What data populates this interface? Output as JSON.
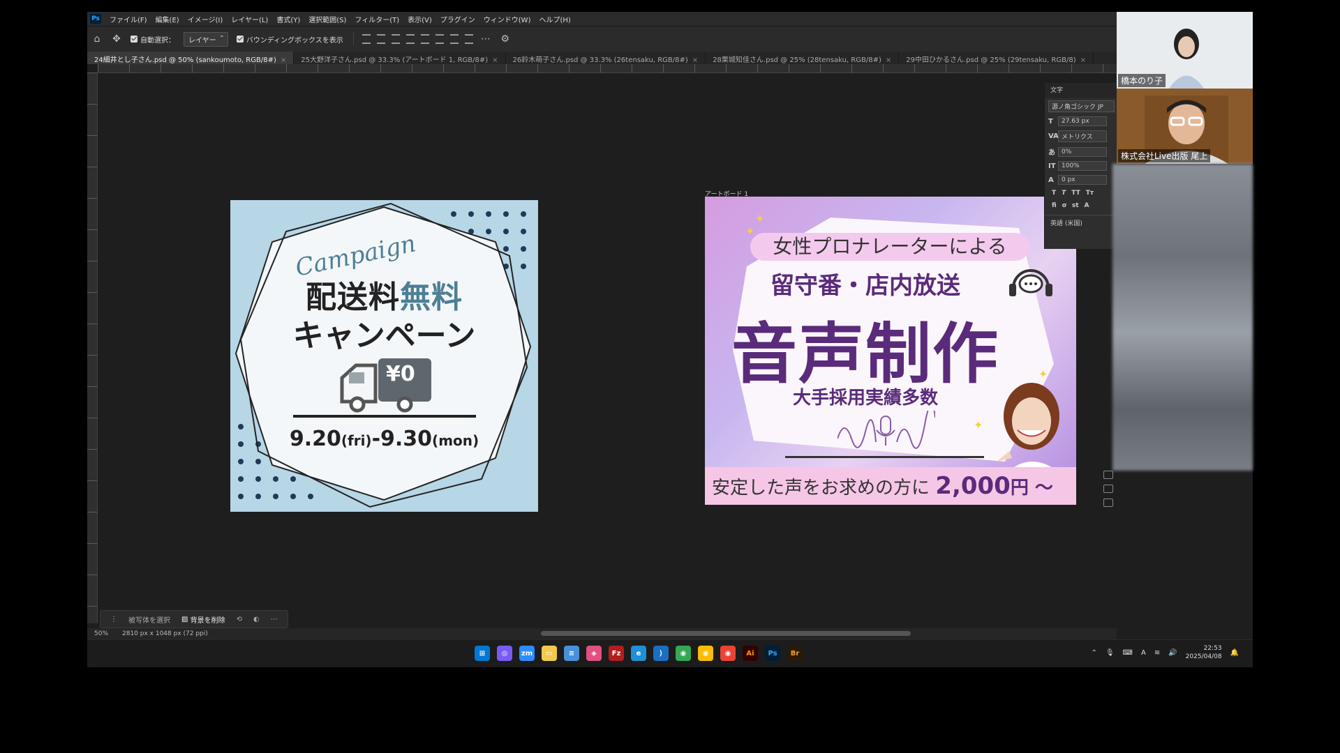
{
  "menu": {
    "items": [
      "ファイル(F)",
      "編集(E)",
      "イメージ(I)",
      "レイヤー(L)",
      "書式(Y)",
      "選択範囲(S)",
      "フィルター(T)",
      "表示(V)",
      "プラグイン",
      "ウィンドウ(W)",
      "ヘルプ(H)"
    ]
  },
  "options": {
    "auto_select": "自動選択：",
    "layer_select": "レイヤー",
    "bounding_box": "バウンディングボックスを表示"
  },
  "tabs": [
    {
      "label": "24細井とし子さん.psd @ 50% (sankoumoto, RGB/8#)"
    },
    {
      "label": "25大野洋子さん.psd @ 33.3% (アートボード 1, RGB/8#)"
    },
    {
      "label": "26鈴木萌子さん.psd @ 33.3% (26tensaku, RGB/8#)"
    },
    {
      "label": "28栗城知佳さん.psd @ 25% (28tensaku, RGB/8#)"
    },
    {
      "label": "29中田ひかるさん.psd @ 25% (29tensaku, RGB/8)"
    }
  ],
  "artwork_left": {
    "script": "Campaign",
    "title_part1": "配送料",
    "title_part2": "無料",
    "title_line2": "キャンペーン",
    "truck_label": "¥0",
    "date_start": "9.20",
    "date_start_day": "(fri)",
    "date_sep": "-",
    "date_end": "9.30",
    "date_end_day": "(mon)"
  },
  "artboard_label": "アートボード 1",
  "artwork_right": {
    "line1": "女性プロナレーターによる",
    "line2": "留守番・店内放送",
    "line3": "音声制作",
    "line4": "大手採用実績多数",
    "footer_text": "安定した声をお求めの方に",
    "footer_price": "2,000",
    "footer_unit": "円 ～"
  },
  "character_panel": {
    "title": "文字",
    "font": "源ノ角ゴシック JP",
    "size": "27.63 px",
    "kerning": "メトリクス",
    "tracking": "0%",
    "vscale": "100%",
    "baseline": "0 px",
    "language": "英語 (米国)"
  },
  "context_bar": {
    "select_subject": "被写体を選択",
    "remove_bg": "背景を削除"
  },
  "status": {
    "zoom": "50%",
    "doc_size": "2810 px x 1048 px (72 ppi)"
  },
  "taskbar": {
    "time": "22:53",
    "date": "2025/04/08"
  },
  "video": {
    "participant1": "橋本のり子",
    "participant2": "株式会社Live出版 尾上"
  },
  "colors": {
    "accent_blue": "#b7d6e6",
    "accent_purple": "#5a2b7a",
    "pink": "#f6c6e6"
  }
}
